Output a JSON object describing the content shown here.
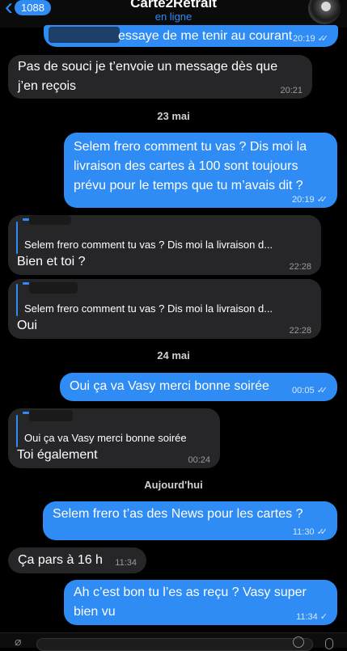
{
  "header": {
    "unread_count": "1088",
    "title": "Carte2Retrait",
    "status": "en ligne"
  },
  "messages": [
    {
      "text": "essaye de me tenir au courant",
      "time": "20:19",
      "direction": "out",
      "read": true
    },
    {
      "text": "Pas de souci je t’envoie un message dès que j’en reçois",
      "time": "20:21",
      "direction": "in"
    },
    {
      "date": "23 mai"
    },
    {
      "text": "Selem frero comment tu vas ? Dis moi la livraison des cartes à 100 sont toujours prévu pour le temps que tu m’avais dit ?",
      "time": "20:19",
      "direction": "out",
      "read": true
    },
    {
      "reply_to": "Selem frero comment tu vas ? Dis moi la livraison d...",
      "text": "Bien et toi ?",
      "time": "22:28",
      "direction": "in"
    },
    {
      "reply_to": "Selem frero comment tu vas ? Dis moi la livraison d...",
      "text": "Oui",
      "time": "22:28",
      "direction": "in"
    },
    {
      "date": "24 mai"
    },
    {
      "text": "Oui ça va Vasy merci bonne soirée",
      "time": "00:05",
      "direction": "out",
      "read": true
    },
    {
      "reply_to": "Oui ça va Vasy merci bonne soirée",
      "text": "Toi également",
      "time": "00:24",
      "direction": "in"
    },
    {
      "date": "Aujourd'hui"
    },
    {
      "text": "Selem frero t’as des News pour les cartes ?",
      "time": "11:30",
      "direction": "out",
      "read": true
    },
    {
      "text": "Ça pars à 16 h",
      "time": "11:34",
      "direction": "in"
    },
    {
      "text": "Ah c’est bon tu l’es as reçu ? Vasy super bien vu",
      "time": "11:34",
      "direction": "out",
      "read": false
    }
  ],
  "icons": {
    "back": "chevron-left-icon",
    "read_receipt": "double-check-icon",
    "delivered": "single-check-icon",
    "attach": "paperclip-icon",
    "sticker": "sticker-icon",
    "mic": "microphone-icon"
  },
  "colors": {
    "accent": "#2f8cf4",
    "incoming_bubble": "#262628",
    "background": "#000000"
  }
}
